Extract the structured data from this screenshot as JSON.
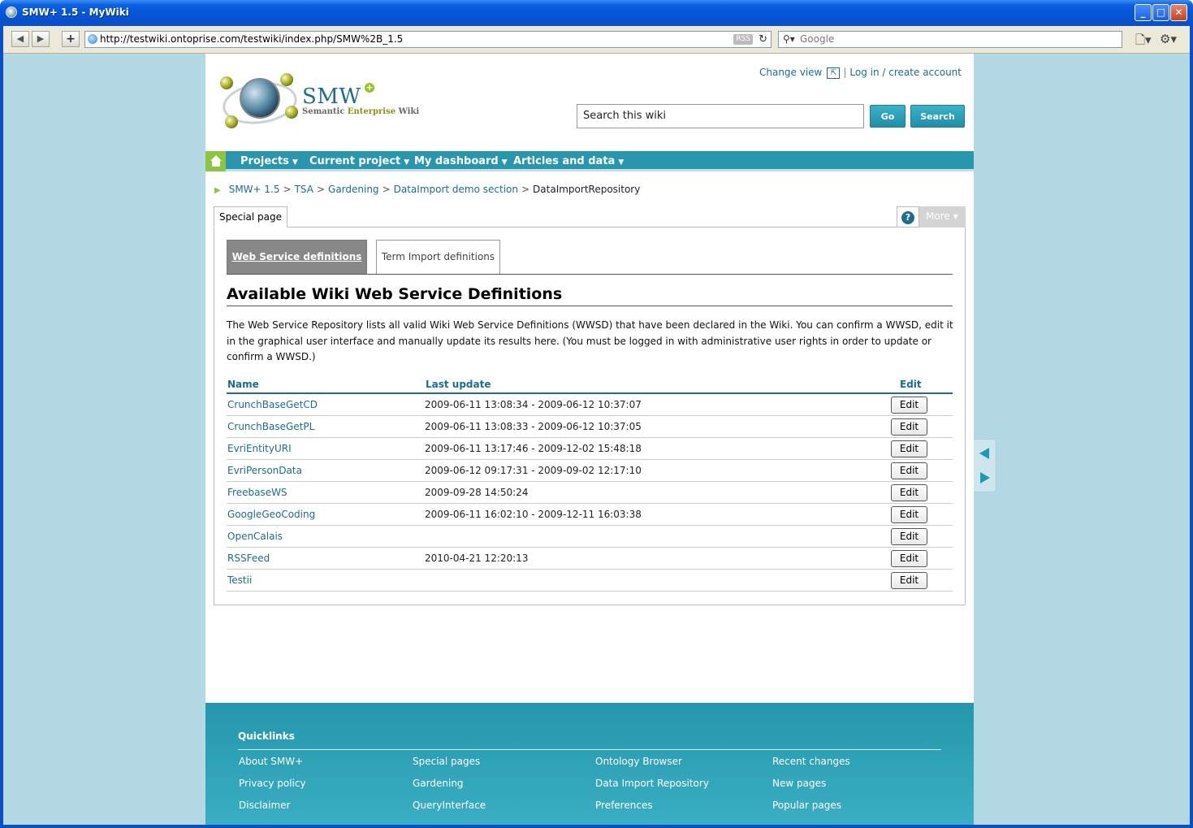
{
  "window": {
    "title": "SMW+ 1.5 - MyWiki",
    "minimize": "_",
    "maximize": "□",
    "close": "✕"
  },
  "browser": {
    "back": "◀",
    "forward": "▶",
    "add": "+",
    "url": "http://testwiki.ontoprise.com/testwiki/index.php/SMW%2B_1.5",
    "rss": "RSS",
    "reload": "↻",
    "search_placeholder": "Google",
    "page_menu": "🗋▾",
    "tools_menu": "⚙▾"
  },
  "header": {
    "brand": "SMW",
    "brand_plus": "+",
    "tagline_1": "Semantic ",
    "tagline_2": "Enterprise",
    "tagline_3": " Wiki",
    "change_view": "Change view",
    "view_icon": "⇱",
    "login": "Log in / create account",
    "search_placeholder": "Search this wiki",
    "go": "Go",
    "search": "Search"
  },
  "menu": [
    {
      "label": "Projects"
    },
    {
      "label": "Current project"
    },
    {
      "label": "My dashboard"
    },
    {
      "label": "Articles and data"
    }
  ],
  "breadcrumb": {
    "arrow": "▶",
    "items": [
      "SMW+ 1.5",
      "TSA",
      "Gardening",
      "DataImport demo section"
    ],
    "sep": ">",
    "current": "DataImportRepository"
  },
  "tabs": {
    "special_page": "Special page",
    "help": "?",
    "more": "More ▾"
  },
  "subtabs": {
    "active": "Web Service definitions",
    "other": "Term Import definitions"
  },
  "section": {
    "title": "Available Wiki Web Service Definitions",
    "description": "The Web Service Repository lists all valid Wiki Web Service Definitions (WWSD) that have been declared in the Wiki. You can confirm a WWSD, edit it in the graphical user interface and manually update its results here. (You must be logged in with administrative user rights in order to update or confirm a WWSD.)"
  },
  "table": {
    "headers": {
      "name": "Name",
      "last_update": "Last update",
      "edit": "Edit"
    },
    "rows": [
      {
        "name": "CrunchBaseGetCD",
        "last_update": "2009-06-11 13:08:34 - 2009-06-12 10:37:07",
        "edit": "Edit"
      },
      {
        "name": "CrunchBaseGetPL",
        "last_update": "2009-06-11 13:08:33 - 2009-06-12 10:37:05",
        "edit": "Edit"
      },
      {
        "name": "EvriEntityURI",
        "last_update": "2009-06-11 13:17:46 - 2009-12-02 15:48:18",
        "edit": "Edit"
      },
      {
        "name": "EvriPersonData",
        "last_update": "2009-06-12 09:17:31 - 2009-09-02 12:17:10",
        "edit": "Edit"
      },
      {
        "name": "FreebaseWS",
        "last_update": "2009-09-28 14:50:24",
        "edit": "Edit"
      },
      {
        "name": "GoogleGeoCoding",
        "last_update": "2009-06-11 16:02:10 - 2009-12-11 16:03:38",
        "edit": "Edit"
      },
      {
        "name": "OpenCalais",
        "last_update": "",
        "edit": "Edit"
      },
      {
        "name": "RSSFeed",
        "last_update": "2010-04-21 12:20:13",
        "edit": "Edit"
      },
      {
        "name": "Testii",
        "last_update": "",
        "edit": "Edit"
      }
    ]
  },
  "footer": {
    "title": "Quicklinks",
    "columns": [
      [
        "About SMW+",
        "Privacy policy",
        "Disclaimer"
      ],
      [
        "Special pages",
        "Gardening",
        "QueryInterface"
      ],
      [
        "Ontology Browser",
        "Data Import Repository",
        "Preferences"
      ],
      [
        "Recent changes",
        "New pages",
        "Popular pages"
      ]
    ]
  },
  "colors": {
    "teal": "#2897ad",
    "link": "#1e6d8c",
    "green": "#8cc63f",
    "page_bg": "#b3d9e4"
  }
}
